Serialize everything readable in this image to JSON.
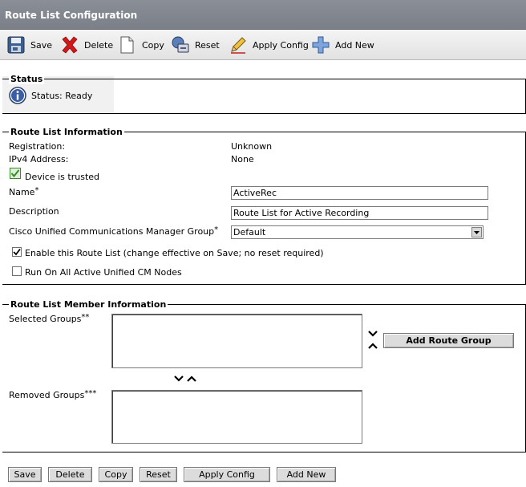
{
  "header": {
    "title": "Route List Configuration"
  },
  "toolbar": {
    "save": "Save",
    "delete": "Delete",
    "copy": "Copy",
    "reset": "Reset",
    "apply_config": "Apply Config",
    "add_new": "Add New"
  },
  "status": {
    "legend": "Status",
    "text": "Status: Ready"
  },
  "info": {
    "legend": "Route List Information",
    "registration_label": "Registration:",
    "registration_value": "Unknown",
    "ipv4_label": "IPv4 Address:",
    "ipv4_value": "None",
    "trusted_label": "Device is trusted",
    "name_label": "Name",
    "name_value": "ActiveRec",
    "description_label": "Description",
    "description_value": "Route List for Active Recording",
    "cucm_group_label": "Cisco Unified Communications Manager Group",
    "cucm_group_value": "Default",
    "enable_label": "Enable this Route List (change effective on Save; no reset required)",
    "enable_checked": true,
    "run_all_label": "Run On All Active Unified CM Nodes",
    "run_all_checked": false
  },
  "members": {
    "legend": "Route List Member Information",
    "selected_label": "Selected Groups",
    "selected_marker": "**",
    "removed_label": "Removed Groups",
    "removed_marker": "***",
    "add_route_group": "Add Route Group"
  },
  "required_marker": "*",
  "bottom": {
    "save": "Save",
    "delete": "Delete",
    "copy": "Copy",
    "reset": "Reset",
    "apply_config": "Apply Config",
    "add_new": "Add New"
  },
  "colors": {
    "title_bar": "#7f848c",
    "info_icon": "#3a5da8",
    "check_green": "#3a8a2a",
    "delete_red": "#d01a1a"
  }
}
